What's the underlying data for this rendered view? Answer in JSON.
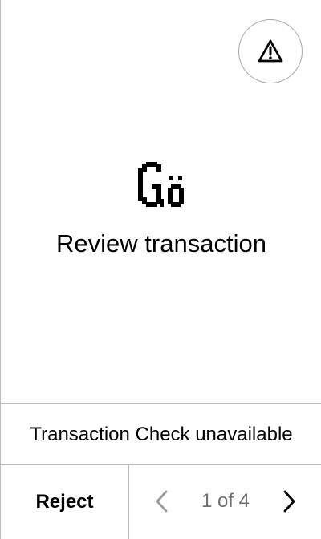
{
  "header": {
    "warning_icon": "warning-triangle-icon"
  },
  "hero": {
    "logo_text": "Gö",
    "title": "Review transaction"
  },
  "transaction_check": {
    "status_text": "Transaction Check unavailable"
  },
  "footer": {
    "reject_label": "Reject",
    "page_indicator": "1 of 4",
    "prev_icon": "chevron-left-icon",
    "next_icon": "chevron-right-icon"
  },
  "colors": {
    "text": "#000000",
    "muted_text": "#707070",
    "divider": "#b8b8b8",
    "disabled_icon": "#9a9a9a"
  }
}
